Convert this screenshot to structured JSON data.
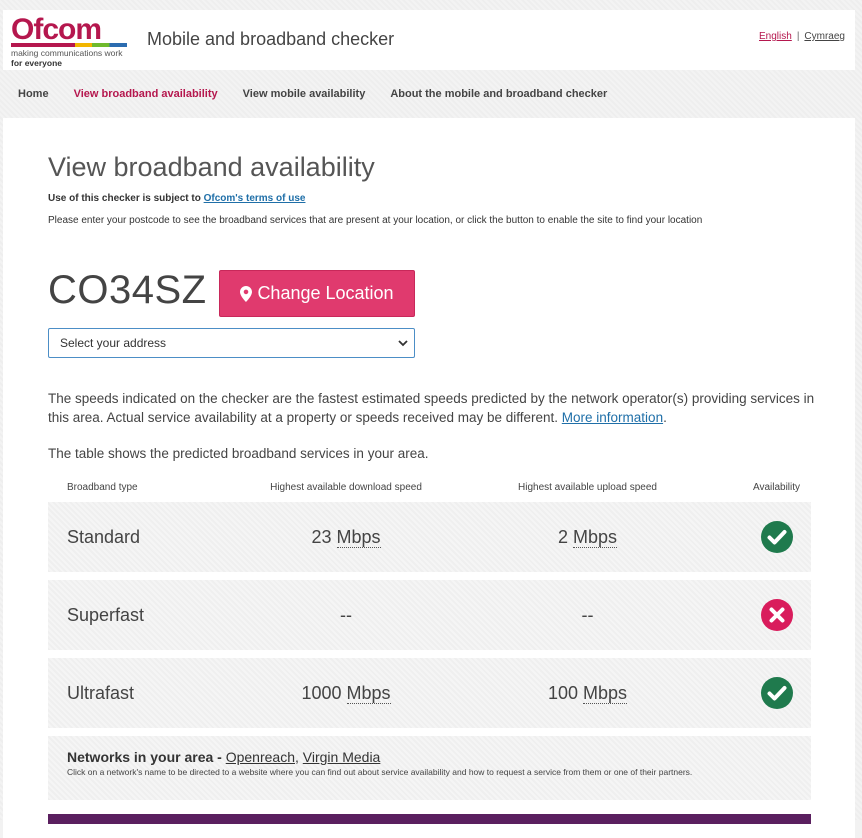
{
  "header": {
    "logo_word": "Ofcom",
    "logo_tagline_1": "making communications work",
    "logo_tagline_2": "for everyone",
    "site_title": "Mobile and broadband checker",
    "lang_english": "English",
    "lang_separator": "|",
    "lang_welsh": "Cymraeg",
    "logo_colors": [
      "#b5174e",
      "#f2b600",
      "#6fba2c",
      "#2b6cb0"
    ]
  },
  "nav": {
    "items": [
      {
        "label": "Home",
        "active": false
      },
      {
        "label": "View broadband availability",
        "active": true
      },
      {
        "label": "View mobile availability",
        "active": false
      },
      {
        "label": "About the mobile and broadband checker",
        "active": false
      }
    ]
  },
  "main": {
    "title": "View broadband availability",
    "terms_prefix": "Use of this checker is subject to",
    "terms_link": "Ofcom's terms of use",
    "instructions": "Please enter your postcode to see the broadband services that are present at your location, or click the button to enable the site to find your location",
    "postcode": "CO34SZ",
    "change_location_label": "Change Location",
    "address_select_value": "Select your address",
    "description": "The speeds indicated on the checker are the fastest estimated speeds predicted by the network operator(s) providing services in this area. Actual service availability at a property or speeds received may be different.",
    "more_info_link": "More information",
    "description_end": ".",
    "table_intro": "The table shows the predicted broadband services in your area."
  },
  "table": {
    "headers": [
      "Broadband type",
      "Highest available download speed",
      "Highest available upload speed",
      "Availability"
    ],
    "rows": [
      {
        "type": "Standard",
        "download": "23",
        "download_unit": "Mbps",
        "upload": "2",
        "upload_unit": "Mbps",
        "available": true
      },
      {
        "type": "Superfast",
        "download": "--",
        "download_unit": "",
        "upload": "--",
        "upload_unit": "",
        "available": false
      },
      {
        "type": "Ultrafast",
        "download": "1000",
        "download_unit": "Mbps",
        "upload": "100",
        "upload_unit": "Mbps",
        "available": true
      }
    ],
    "status_colors": {
      "available": "#1f7a4d",
      "unavailable": "#d91c5c"
    }
  },
  "networks": {
    "title": "Networks in your area -",
    "links": [
      "Openreach",
      "Virgin Media"
    ],
    "separator": ",",
    "note": "Click on a network's name to be directed to a website where you can find out about service availability and how to request a service from them or one of their partners."
  },
  "colors": {
    "accent": "#b5174e",
    "button": "#e03a6e",
    "link": "#1f6fa8",
    "footer_bar": "#5a1f5f"
  }
}
